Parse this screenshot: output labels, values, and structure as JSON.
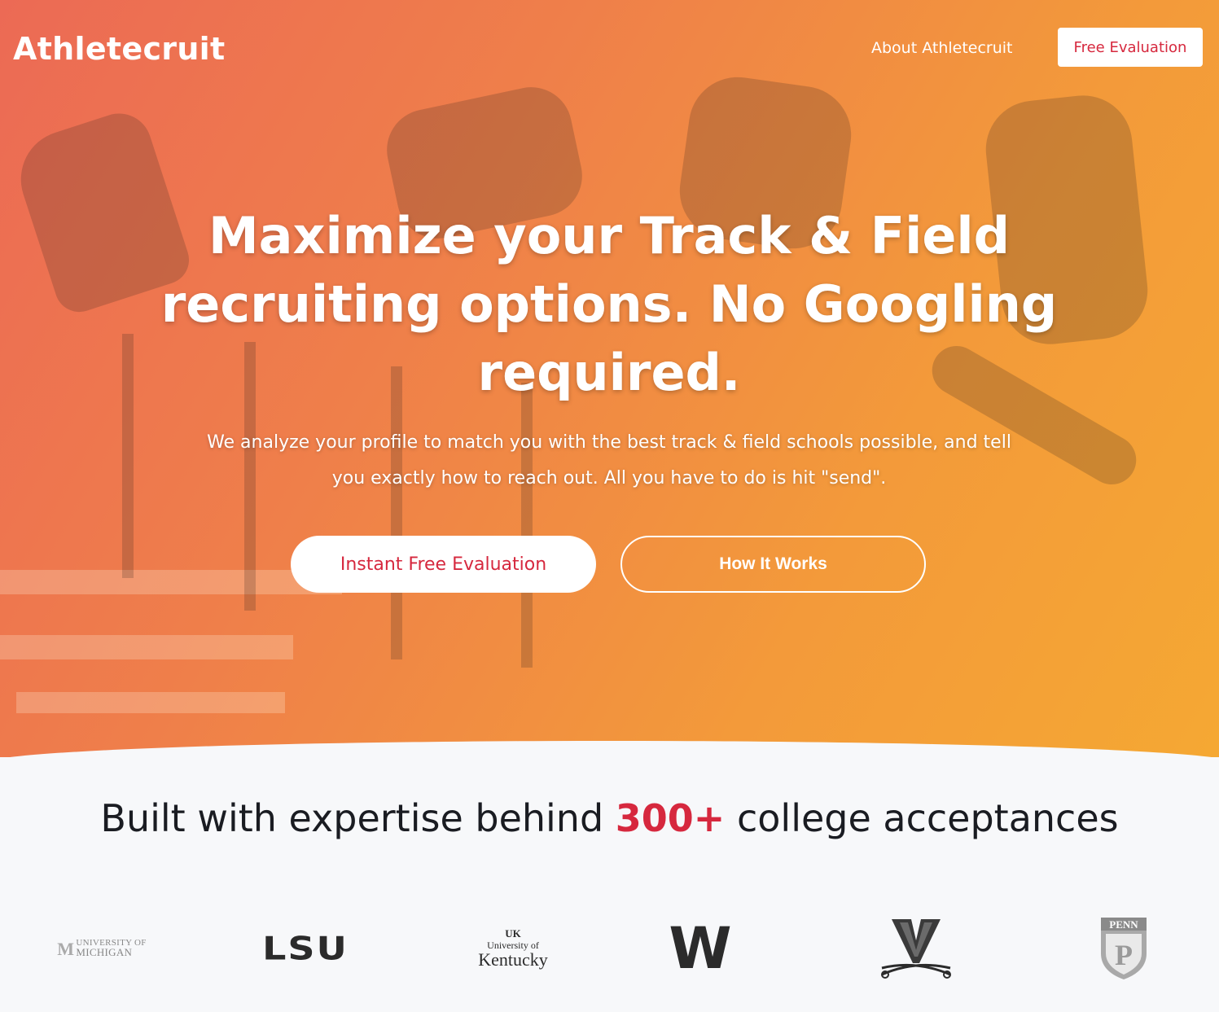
{
  "header": {
    "logo": "Athletecruit",
    "nav_about": "About Athletecruit",
    "nav_cta": "Free Evaluation"
  },
  "hero": {
    "headline": "Maximize your Track & Field recruiting options. No Googling required.",
    "subtext": "We analyze your profile to match you with the best track & field schools possible, and tell you exactly how to reach out. All you have to do is hit \"send\".",
    "primary_cta": "Instant Free Evaluation",
    "secondary_cta": "How It Works"
  },
  "acceptances": {
    "prefix": "Built with expertise behind",
    "number": "300+",
    "suffix": "college acceptances"
  },
  "schools": {
    "michigan": {
      "line1": "UNIVERSITY OF",
      "line2": "MICHIGAN",
      "mark": "M"
    },
    "lsu": "LSU",
    "kentucky": {
      "mark": "UK",
      "line1": "University of",
      "line2": "Kentucky"
    },
    "washington": "W",
    "virginia": "V",
    "penn": {
      "banner": "PENN",
      "mark": "P"
    }
  },
  "colors": {
    "accent": "#d6283e",
    "gradient_start": "#ec6a55",
    "gradient_end": "#f5a833",
    "text_dark": "#1a1c22",
    "section_bg": "#f7f8fa"
  }
}
